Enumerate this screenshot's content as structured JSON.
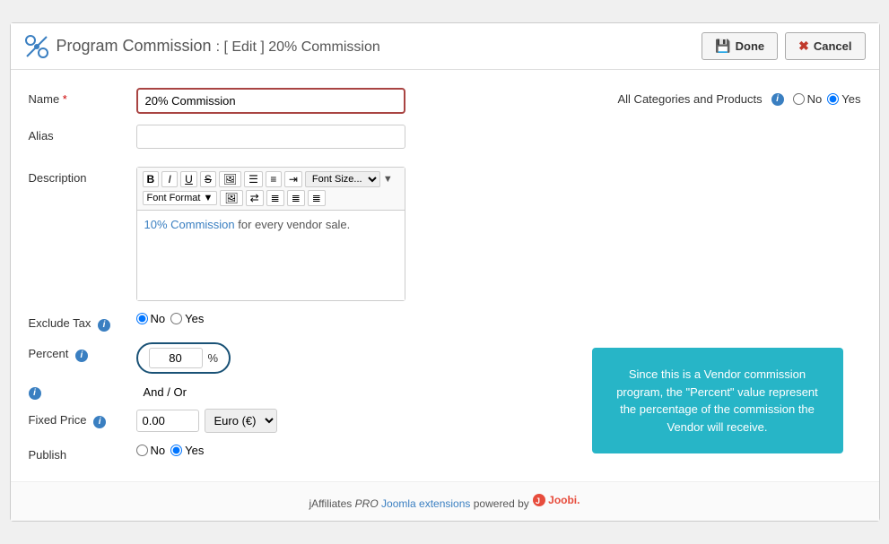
{
  "header": {
    "icon": "⚙",
    "title": "Program Commission",
    "subtitle": ": [ Edit ] 20% Commission",
    "done_label": "Done",
    "cancel_label": "Cancel"
  },
  "form": {
    "name_label": "Name",
    "name_value": "20% Commission",
    "alias_label": "Alias",
    "alias_value": "",
    "description_label": "Description",
    "all_categories_label": "All Categories and Products",
    "info_icon": "i",
    "radio_no": "No",
    "radio_yes": "Yes",
    "editor_content_text": "10% Commission",
    "editor_content_rest": " for every vendor sale.",
    "exclude_tax_label": "Exclude Tax",
    "exclude_no": "No",
    "exclude_yes": "Yes",
    "percent_label": "Percent",
    "percent_value": "80",
    "percent_sign": "%",
    "andor_label": "And / Or",
    "fixed_price_label": "Fixed Price",
    "fixed_price_value": "0.00",
    "currency_option": "Euro (€)",
    "publish_label": "Publish",
    "publish_no": "No",
    "publish_yes": "Yes",
    "toolbar": {
      "bold": "B",
      "italic": "I",
      "underline": "U",
      "strikethrough": "S̶",
      "image": "🖼",
      "ol": "≡",
      "ul": "≡",
      "indent": "⇥",
      "font_size_label": "Font Size...",
      "font_format_label": "Font Format",
      "align_left": "≡",
      "align_center": "≡",
      "align_right": "≡",
      "align_justify": "≡"
    }
  },
  "info_box": {
    "text": "Since this is a Vendor commission program, the \"Percent\" value represent the percentage of the commission the Vendor will receive."
  },
  "footer": {
    "text": "jAffiliates",
    "pro": "PRO",
    "joomla": "Joomla extensions",
    "powered": "powered by",
    "joobi": "Joobi."
  }
}
